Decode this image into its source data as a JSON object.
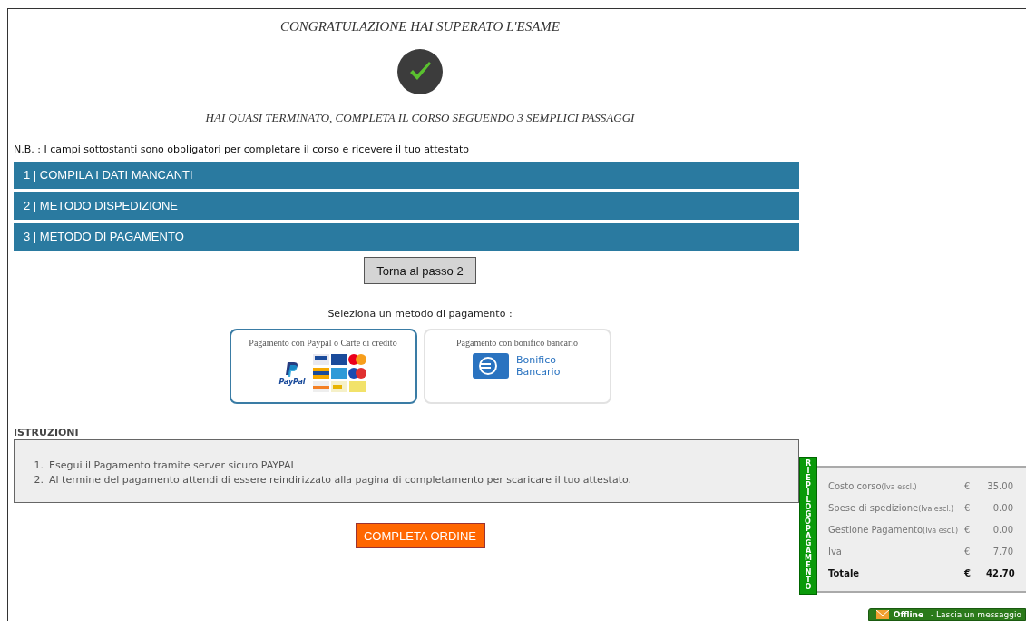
{
  "title": "CONGRATULAZIONE HAI SUPERATO L'ESAME",
  "subtitle": "HAI QUASI TERMINATO, COMPLETA IL CORSO SEGUENDO 3 SEMPLICI PASSAGGI",
  "note": "N.B. : I campi sottostanti sono obbligatori per completare il corso e ricevere il tuo attestato",
  "steps": [
    {
      "label": "1 | COMPILA I DATI MANCANTI"
    },
    {
      "label": "2 | METODO DISPEDIZIONE"
    },
    {
      "label": "3 | METODO DI PAGAMENTO"
    }
  ],
  "back_button": "Torna al passo 2",
  "payment_prompt": "Seleziona un metodo di pagamento :",
  "payment_methods": [
    {
      "kind": "paypal",
      "label": "Pagamento con Paypal o Carte di credito",
      "logo_text": "PayPal",
      "selected": true
    },
    {
      "kind": "bank",
      "label": "Pagamento con bonifico bancario",
      "logo_text": "Bonifico Bancario",
      "selected": false
    }
  ],
  "instructions": {
    "heading": "ISTRUZIONI",
    "items": [
      {
        "number": "1.",
        "text": "Esegui il Pagamento tramite server sicuro PAYPAL"
      },
      {
        "number": "2.",
        "text": "Al termine del pagamento attendi di essere reindirizzato alla pagina di completamento per scaricare il tuo attestato."
      }
    ]
  },
  "complete_button": "COMPLETA ORDINE",
  "summary": {
    "tab": "RIEPILOGO PAGAMENTO",
    "rows": [
      {
        "label": "Costo corso",
        "note": "(Iva escl.)",
        "currency": "€",
        "amount": "35.00",
        "total": false
      },
      {
        "label": "Spese di spedizione",
        "note": "(Iva escl.)",
        "currency": "€",
        "amount": "0.00",
        "total": false
      },
      {
        "label": "Gestione Pagamento",
        "note": "(Iva escl.)",
        "currency": "€",
        "amount": "0.00",
        "total": false
      },
      {
        "label": "Iva",
        "currency": "€",
        "amount": "7.70",
        "total": false
      },
      {
        "label": "Totale",
        "currency": "€",
        "amount": "42.70",
        "total": true
      }
    ]
  },
  "chat": {
    "status": "Offline",
    "message": "- Lascia un messaggio"
  }
}
